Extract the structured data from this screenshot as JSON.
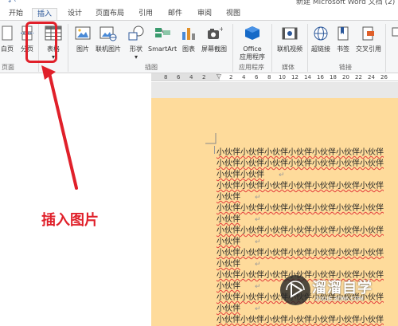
{
  "window": {
    "title": "新建 Microsoft Word 文档 (2)"
  },
  "tabs": [
    {
      "label": "开始"
    },
    {
      "label": "插入"
    },
    {
      "label": "设计"
    },
    {
      "label": "页面布局"
    },
    {
      "label": "引用"
    },
    {
      "label": "邮件"
    },
    {
      "label": "审阅"
    },
    {
      "label": "视图"
    }
  ],
  "ribbon": {
    "buttons": [
      {
        "label": "白页",
        "icon": "blank-page-icon"
      },
      {
        "label": "分页",
        "icon": "page-break-icon"
      },
      {
        "label": "表格",
        "icon": "table-icon"
      },
      {
        "label": "图片",
        "icon": "picture-icon"
      },
      {
        "label": "联机图片",
        "icon": "online-picture-icon"
      },
      {
        "label": "形状",
        "icon": "shapes-icon"
      },
      {
        "label": "SmartArt",
        "icon": "smartart-icon"
      },
      {
        "label": "图表",
        "icon": "chart-icon"
      },
      {
        "label": "屏幕截图",
        "icon": "screenshot-icon"
      },
      {
        "label": "Office",
        "label2": "应用程序",
        "icon": "office-apps-icon"
      },
      {
        "label": "联机视频",
        "icon": "online-video-icon"
      },
      {
        "label": "超链接",
        "icon": "hyperlink-icon"
      },
      {
        "label": "书签",
        "icon": "bookmark-icon"
      },
      {
        "label": "交叉引用",
        "icon": "cross-reference-icon"
      }
    ],
    "groups": [
      {
        "label": "页面"
      },
      {
        "label": "表格"
      },
      {
        "label": "插图"
      },
      {
        "label": "应用程序"
      },
      {
        "label": "媒体"
      },
      {
        "label": "链接"
      }
    ]
  },
  "ruler": {
    "ticks": [
      "8",
      "6",
      "4",
      "2",
      "2",
      "4",
      "6",
      "8",
      "10",
      "12",
      "14",
      "16",
      "18",
      "20",
      "22",
      "24",
      "26"
    ]
  },
  "document": {
    "lines": [
      {
        "text": "小伙伴小伙伴小伙伴小伙伴小伙伴小伙伴小伙伴",
        "mark": ""
      },
      {
        "text": "小伙伴小伙伴小伙伴小伙伴小伙伴小伙伴小伙伴",
        "mark": ""
      },
      {
        "text": "小伙伴小伙伴",
        "mark": "↵"
      },
      {
        "text": "小伙伴小伙伴小伙伴小伙伴小伙伴小伙伴小伙伴",
        "mark": ""
      },
      {
        "text": "小伙伴",
        "mark": "↵"
      },
      {
        "text": "小伙伴小伙伴小伙伴小伙伴小伙伴小伙伴小伙伴",
        "mark": ""
      },
      {
        "text": "小伙伴",
        "mark": "↵"
      },
      {
        "text": "小伙伴小伙伴小伙伴小伙伴小伙伴小伙伴小伙伴",
        "mark": ""
      },
      {
        "text": "小伙伴",
        "mark": "↵"
      },
      {
        "text": "小伙伴小伙伴小伙伴小伙伴小伙伴小伙伴小伙伴",
        "mark": ""
      },
      {
        "text": "小伙伴",
        "mark": "↵"
      },
      {
        "text": "小伙伴小伙伴小伙伴小伙伴小伙伴小伙伴小伙伴",
        "mark": ""
      },
      {
        "text": "小伙伴",
        "mark": "↵"
      },
      {
        "text": "小伙伴小伙伴小伙伴小伙伴小伙伴小伙伴小伙伴",
        "mark": ""
      },
      {
        "text": "小伙伴",
        "mark": "↵"
      },
      {
        "text": "小伙伴小伙伴小伙伴小伙伴小伙伴小伙伴小伙伴",
        "mark": ""
      }
    ]
  },
  "annotation": {
    "callout": "插入图片",
    "color": "#e0202a"
  },
  "watermark": {
    "name": "溜溜自学",
    "url": "ZIXUE.3D66.COM"
  },
  "colors": {
    "accent": "#2b579a",
    "page": "#fedb9b",
    "ribbon": "#f5f6f7"
  }
}
